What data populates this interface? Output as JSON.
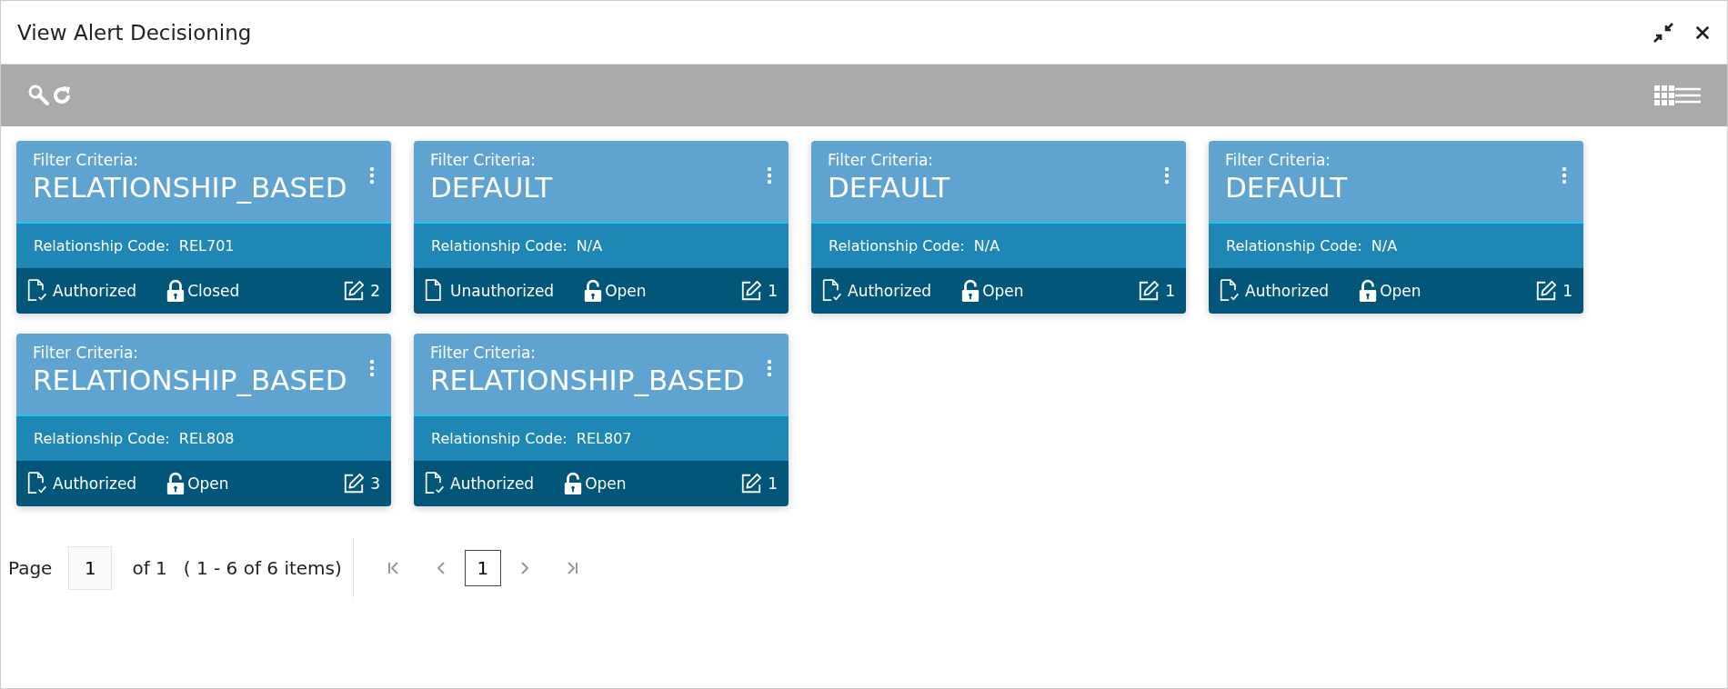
{
  "window": {
    "title": "View Alert Decisioning"
  },
  "cards": [
    {
      "criteria_label": "Filter Criteria:",
      "criteria": "RELATIONSHIP_BASED",
      "code_label": "Relationship Code:",
      "code": "REL701",
      "authorized": true,
      "auth_text": "Authorized",
      "locked": true,
      "lock_text": "Closed",
      "edits": "2"
    },
    {
      "criteria_label": "Filter Criteria:",
      "criteria": "DEFAULT",
      "code_label": "Relationship Code:",
      "code": "N/A",
      "authorized": false,
      "auth_text": "Unauthorized",
      "locked": false,
      "lock_text": "Open",
      "edits": "1"
    },
    {
      "criteria_label": "Filter Criteria:",
      "criteria": "DEFAULT",
      "code_label": "Relationship Code:",
      "code": "N/A",
      "authorized": true,
      "auth_text": "Authorized",
      "locked": false,
      "lock_text": "Open",
      "edits": "1"
    },
    {
      "criteria_label": "Filter Criteria:",
      "criteria": "DEFAULT",
      "code_label": "Relationship Code:",
      "code": "N/A",
      "authorized": true,
      "auth_text": "Authorized",
      "locked": false,
      "lock_text": "Open",
      "edits": "1"
    },
    {
      "criteria_label": "Filter Criteria:",
      "criteria": "RELATIONSHIP_BASED",
      "code_label": "Relationship Code:",
      "code": "REL808",
      "authorized": true,
      "auth_text": "Authorized",
      "locked": false,
      "lock_text": "Open",
      "edits": "3"
    },
    {
      "criteria_label": "Filter Criteria:",
      "criteria": "RELATIONSHIP_BASED",
      "code_label": "Relationship Code:",
      "code": "REL807",
      "authorized": true,
      "auth_text": "Authorized",
      "locked": false,
      "lock_text": "Open",
      "edits": "1"
    }
  ],
  "pagination": {
    "page_label": "Page",
    "page_value": "1",
    "of_text": "of 1",
    "range_text": "( 1 - 6 of 6 items)",
    "current_page": "1"
  }
}
